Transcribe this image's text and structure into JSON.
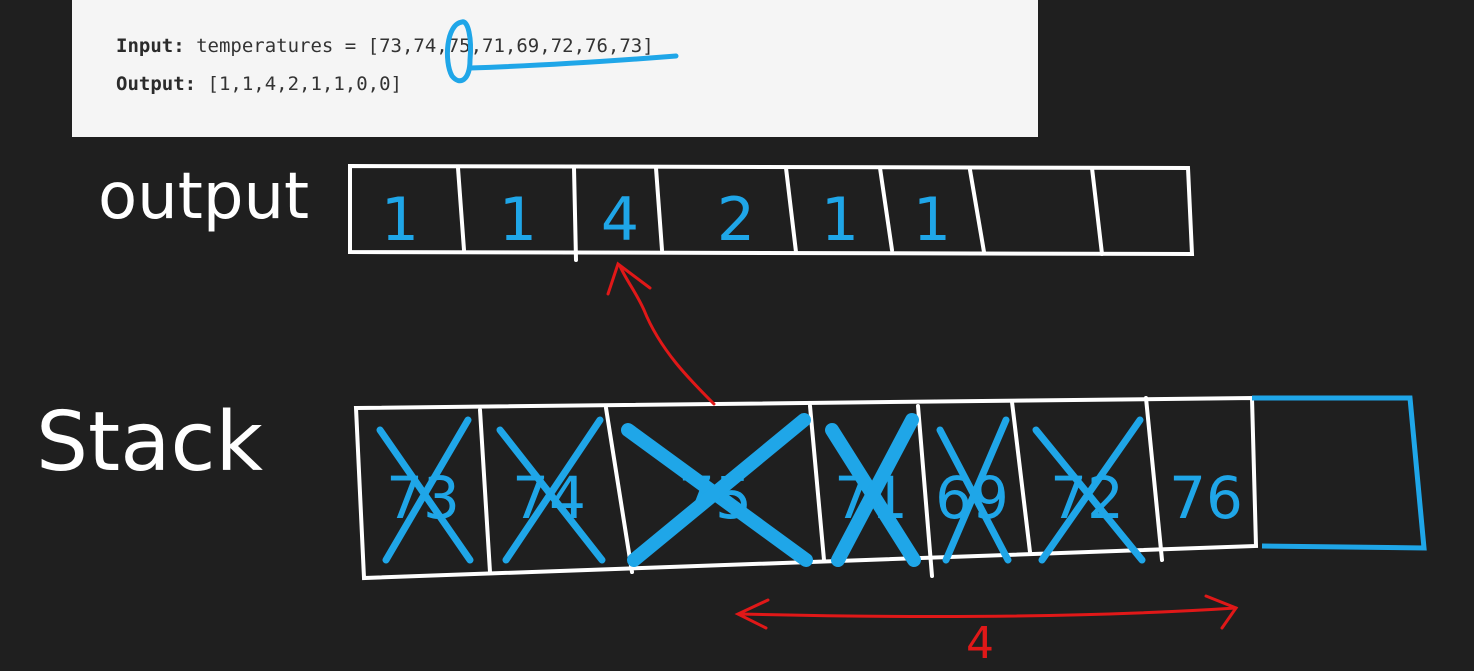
{
  "problem": {
    "input_label": "Input:",
    "input_text": " temperatures = [73,74,75,71,69,72,76,73]",
    "output_label": "Output:",
    "output_text": " [1,1,4,2,1,1,0,0]"
  },
  "board": {
    "output_label": "output",
    "output_cells": [
      "1",
      "1",
      "4",
      "2",
      "1",
      "1",
      "",
      ""
    ],
    "stack_label": "Stack",
    "stack_cells": [
      "73",
      "74",
      "75",
      "71",
      "69",
      "72",
      "76",
      ""
    ],
    "crossed_out": [
      true,
      true,
      true,
      true,
      true,
      true,
      false,
      false
    ],
    "distance_label": "4"
  },
  "colors": {
    "background": "#1f1f1f",
    "chalk": "#ffffff",
    "ink_blue": "#1fa6e8",
    "ink_red": "#e01818",
    "paper": "#f5f5f5"
  }
}
